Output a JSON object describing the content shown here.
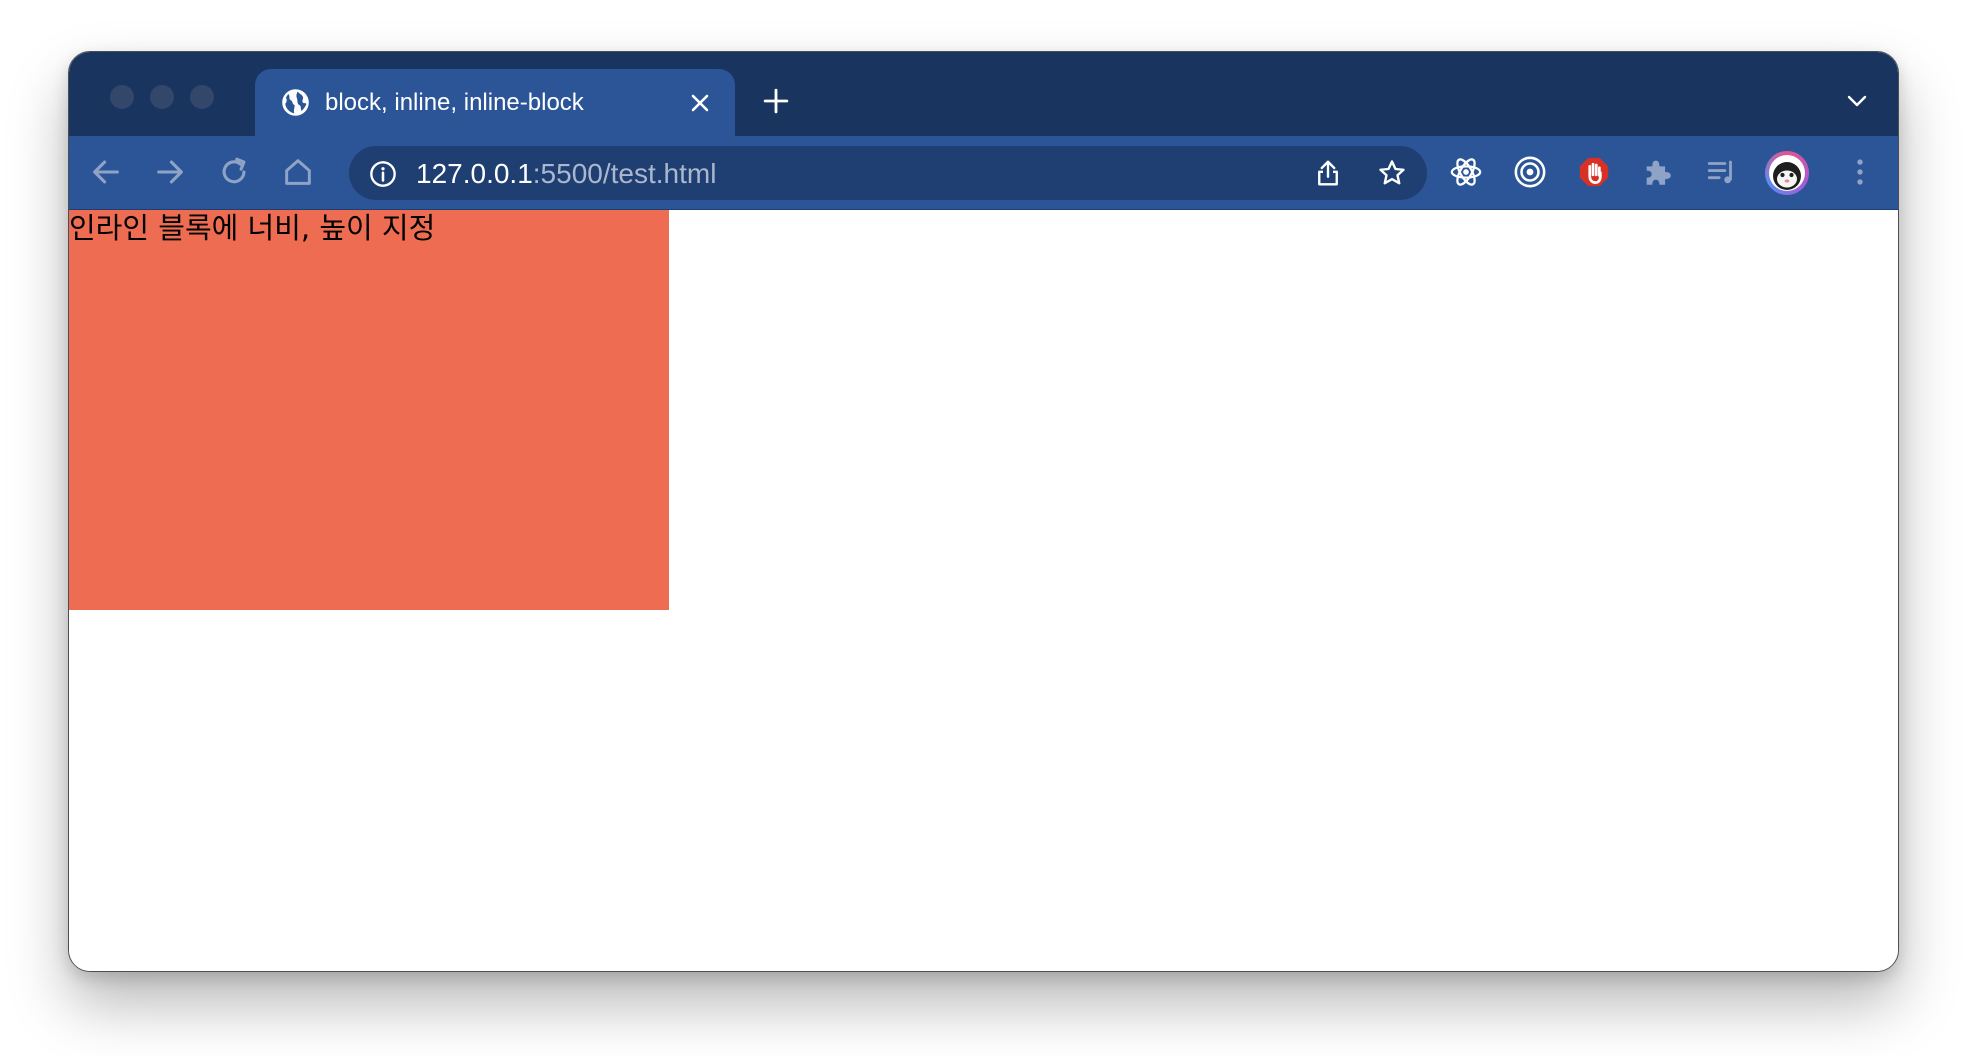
{
  "browser": {
    "tab": {
      "title": "block, inline, inline-block",
      "icon": "globe-icon"
    },
    "address_bar": {
      "url_host": "127.0.0.1",
      "url_rest": ":5500/test.html",
      "icon": "info-icon"
    },
    "extensions": [
      "react-devtools-icon",
      "target-icon",
      "hand-stop-icon",
      "puzzle-extensions-icon",
      "reading-list-icon"
    ],
    "colors": {
      "tab_strip": "#1a3460",
      "toolbar": "#2b5597",
      "omnibox": "#1f3f72",
      "stop_extension": "#d93025"
    }
  },
  "page": {
    "box_text": "인라인 블록에 너비, 높이 지정",
    "box_color": "#ee6c52"
  }
}
